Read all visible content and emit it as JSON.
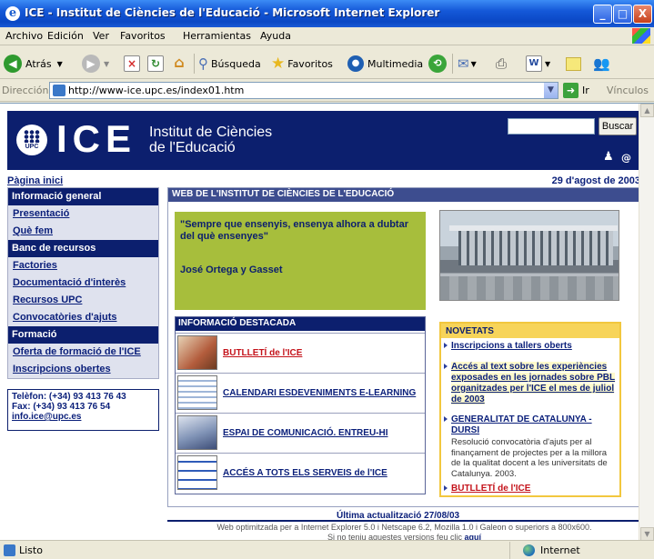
{
  "window": {
    "title": "ICE - Institut de Ciències de l'Educació - Microsoft Internet Explorer",
    "min_glyph": "_",
    "max_glyph": "□",
    "close_glyph": "X"
  },
  "menu": [
    "Archivo",
    "Edición",
    "Ver",
    "Favoritos",
    "Herramientas",
    "Ayuda"
  ],
  "toolbar": {
    "back": "Atrás",
    "search": "Búsqueda",
    "favorites": "Favoritos",
    "multimedia": "Multimedia"
  },
  "address": {
    "label": "Dirección",
    "url": "http://www-ice.upc.es/index01.htm",
    "go": "Ir",
    "links": "Vínculos"
  },
  "site": {
    "logo_badge": "UPC",
    "logo_text": "ICE",
    "institute_line1": "Institut de Ciències",
    "institute_line2": "de l'Educació",
    "search_button": "Buscar",
    "search_value": "",
    "home_link": "Pàgina inici",
    "date": "29 d'agost de 2003"
  },
  "nav": [
    {
      "type": "section",
      "label": "Informació general"
    },
    {
      "type": "item",
      "label": "Presentació"
    },
    {
      "type": "item",
      "label": "Què fem"
    },
    {
      "type": "section",
      "label": "Banc de recursos"
    },
    {
      "type": "item",
      "label": "Factories"
    },
    {
      "type": "item",
      "label": "Documentació d'interès"
    },
    {
      "type": "item",
      "label": "Recursos UPC"
    },
    {
      "type": "item",
      "label": "Convocatòries d'ajuts"
    },
    {
      "type": "section",
      "label": "Formació"
    },
    {
      "type": "item",
      "label": "Oferta de formació de l'ICE"
    },
    {
      "type": "item",
      "label": "Inscripcions obertes"
    }
  ],
  "contact": {
    "phone": "Telèfon: (+34) 93 413 76 43",
    "fax": "Fax: (+34) 93 413 76 54",
    "email": "info.ice@upc.es"
  },
  "main": {
    "header": "WEB DE L'INSTITUT DE CIÈNCIES DE L'EDUCACIÓ",
    "quote": "\"Sempre que ensenyis, ensenya alhora a dubtar del què ensenyes\"",
    "quote_author": "José Ortega y Gasset",
    "featured_title": "INFORMACIÓ DESTACADA",
    "featured": [
      "BUTLLETÍ de l'ICE",
      "CALENDARI ESDEVENIMENTS E-LEARNING",
      "ESPAI DE COMUNICACIÓ. ENTREU-HI",
      "ACCÉS A TOTS ELS SERVEIS de l'ICE"
    ],
    "news_title": "NOVETATS",
    "news": [
      {
        "title": "Inscripcions a tallers oberts"
      },
      {
        "title": "Accés al text sobre les experiències exposades en les jornades sobre PBL organitzades per l'ICE el mes de juliol de 2003"
      },
      {
        "title": "GENERALITAT DE CATALUNYA - DURSI",
        "desc": "Resolució convocatòria d'ajuts per al finançament de projectes per a la millora de la qualitat docent a les universitats de Catalunya. 2003."
      },
      {
        "title": "BUTLLETÍ de l'ICE"
      }
    ]
  },
  "footer": {
    "updated": "Última actualització 27/08/03",
    "compat": "Web optimitzada per a Internet Explorer 5.0 i Netscape 6.2, Mozilla 1.0 i Galeon o superiors a 800x600.",
    "compat2": "Si no teniu aquestes versions feu clic",
    "here": "aquí"
  },
  "status": {
    "text": "Listo",
    "zone": "Internet"
  }
}
